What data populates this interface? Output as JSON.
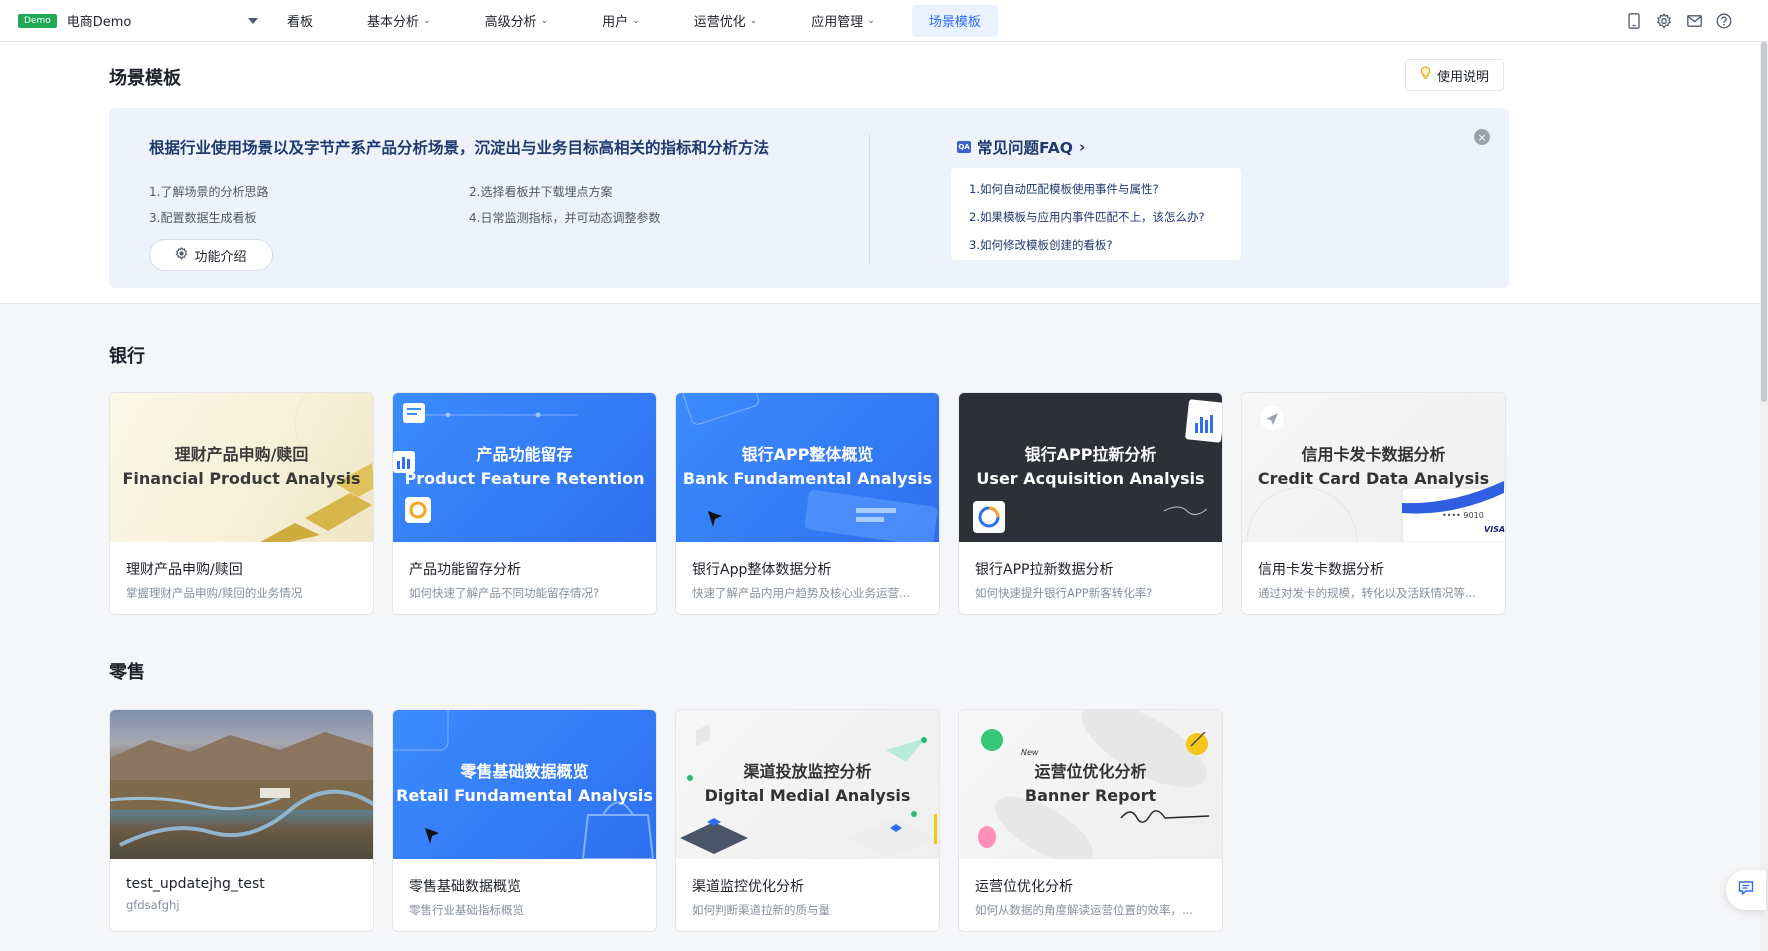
{
  "app": {
    "badge": "Demo",
    "name": "电商Demo"
  },
  "nav": [
    {
      "label": "看板",
      "dropdown": false,
      "active": false
    },
    {
      "label": "基本分析",
      "dropdown": true,
      "active": false
    },
    {
      "label": "高级分析",
      "dropdown": true,
      "active": false
    },
    {
      "label": "用户",
      "dropdown": true,
      "active": false
    },
    {
      "label": "运营优化",
      "dropdown": true,
      "active": false
    },
    {
      "label": "应用管理",
      "dropdown": true,
      "active": false
    },
    {
      "label": "场景模板",
      "dropdown": false,
      "active": true
    }
  ],
  "top_icons": [
    "mobile-icon",
    "gear-icon",
    "mail-icon",
    "help-circle-icon"
  ],
  "page": {
    "title": "场景模板",
    "help_label": "使用说明"
  },
  "banner": {
    "title": "根据行业使用场景以及字节产系产品分析场景，沉淀出与业务目标高相关的指标和分析方法",
    "steps": [
      "1.了解场景的分析思路",
      "2.选择看板并下载埋点方案",
      "3.配置数据生成看板",
      "4.日常监测指标，并可动态调整参数"
    ],
    "feature_btn": "功能介绍",
    "faq_title": "常见问题FAQ",
    "faq_icon": "QA",
    "faq": [
      "1.如何自动匹配模板使用事件与属性?",
      "2.如果模板与应用内事件匹配不上，该怎么办?",
      "3.如何修改模板创建的看板?"
    ]
  },
  "sections": [
    {
      "title": "银行",
      "cards": [
        {
          "cover_cn": "理财产品申购/赎回",
          "cover_en": "Financial Product Analysis",
          "style": "cream",
          "title": "理财产品申购/赎回",
          "desc": "掌握理财产品申购/赎回的业务情况"
        },
        {
          "cover_cn": "产品功能留存",
          "cover_en": "Product Feature Retention",
          "style": "blue",
          "title": "产品功能留存分析",
          "desc": "如何快速了解产品不同功能留存情况?"
        },
        {
          "cover_cn": "银行APP整体概览",
          "cover_en": "Bank Fundamental Analysis",
          "style": "blue",
          "title": "银行App整体数据分析",
          "desc": "快速了解产品内用户趋势及核心业务运营..."
        },
        {
          "cover_cn": "银行APP拉新分析",
          "cover_en": "User Acquisition Analysis",
          "style": "dark",
          "title": "银行APP拉新数据分析",
          "desc": "如何快速提升银行APP新客转化率?"
        },
        {
          "cover_cn": "信用卡发卡数据分析",
          "cover_en": "Credit Card Data Analysis",
          "style": "light",
          "title": "信用卡发卡数据分析",
          "desc": "通过对发卡的规模，转化以及活跃情况等...",
          "card_brand": "VISA",
          "card_digits": "•••• 9010"
        }
      ]
    },
    {
      "title": "零售",
      "cards": [
        {
          "cover_cn": "",
          "cover_en": "",
          "style": "photo",
          "title": "test_updatejhg_test",
          "desc": "gfdsafghj"
        },
        {
          "cover_cn": "零售基础数据概览",
          "cover_en": "Retail Fundamental Analysis",
          "style": "blue",
          "title": "零售基础数据概览",
          "desc": "零售行业基础指标概览"
        },
        {
          "cover_cn": "渠道投放监控分析",
          "cover_en": "Digital Medial Analysis",
          "style": "light",
          "title": "渠道监控优化分析",
          "desc": "如何判断渠道拉新的质与量"
        },
        {
          "cover_cn": "运营位优化分析",
          "cover_en": "Banner Report",
          "style": "light",
          "title": "运营位优化分析",
          "desc": "如何从数据的角度解读运营位置的效率，...",
          "sticker": "New"
        }
      ]
    }
  ]
}
